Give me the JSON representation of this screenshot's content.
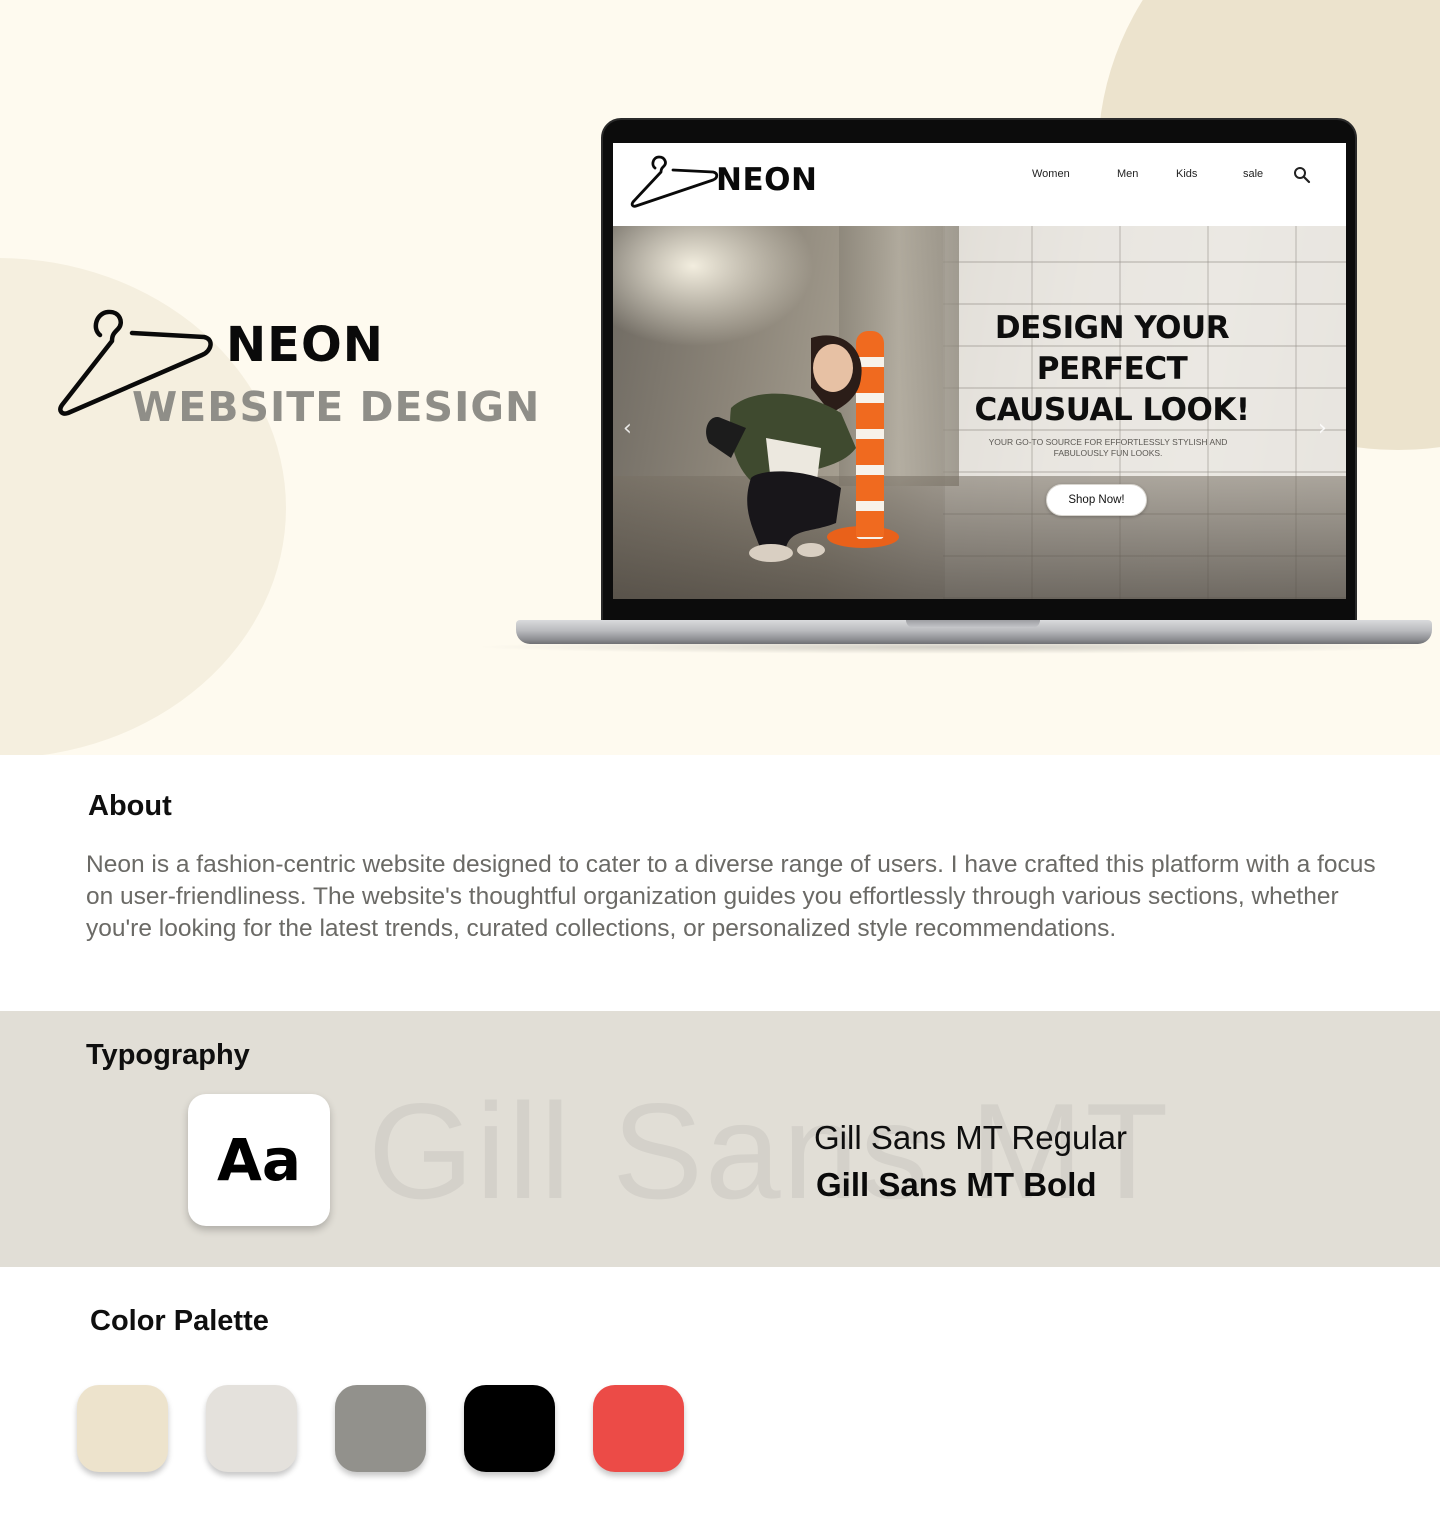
{
  "brand": {
    "name": "NEON",
    "subtitle": "WEBSITE DESIGN"
  },
  "mockup": {
    "logo_text": "NEON",
    "nav": [
      "Women",
      "Men",
      "Kids",
      "sale"
    ],
    "search_icon": "search-icon",
    "headline_lines": [
      "DESIGN YOUR",
      "PERFECT",
      "CAUSUAL LOOK!"
    ],
    "subtext": "YOUR GO-TO SOURCE FOR EFFORTLESSLY STYLISH AND FABULOUSLY FUN LOOKS.",
    "cta": "Shop Now!",
    "prev_arrow": "‹",
    "next_arrow": "›"
  },
  "about": {
    "title": "About",
    "text": "Neon is a fashion-centric website designed to cater to a diverse range of users. I have crafted this platform with a focus on user-friendliness. The website's thoughtful organization guides you effortlessly through various sections, whether you're looking for the latest trends, curated collections, or personalized style recommendations."
  },
  "typography": {
    "title": "Typography",
    "sample": "Aa",
    "watermark": "Gill Sans MT",
    "fonts": [
      "Gill Sans MT Regular",
      "Gill Sans MT Bold"
    ]
  },
  "palette": {
    "title": "Color Palette",
    "colors": [
      "#ede3cc",
      "#e4e1dc",
      "#92918c",
      "#000000",
      "#ec4b47"
    ]
  },
  "theme": {
    "hero_bg": "#fefaef",
    "accent_beige": "#ece3cd",
    "typography_bg": "#e1ded6",
    "muted_gray": "#8f8e88"
  }
}
